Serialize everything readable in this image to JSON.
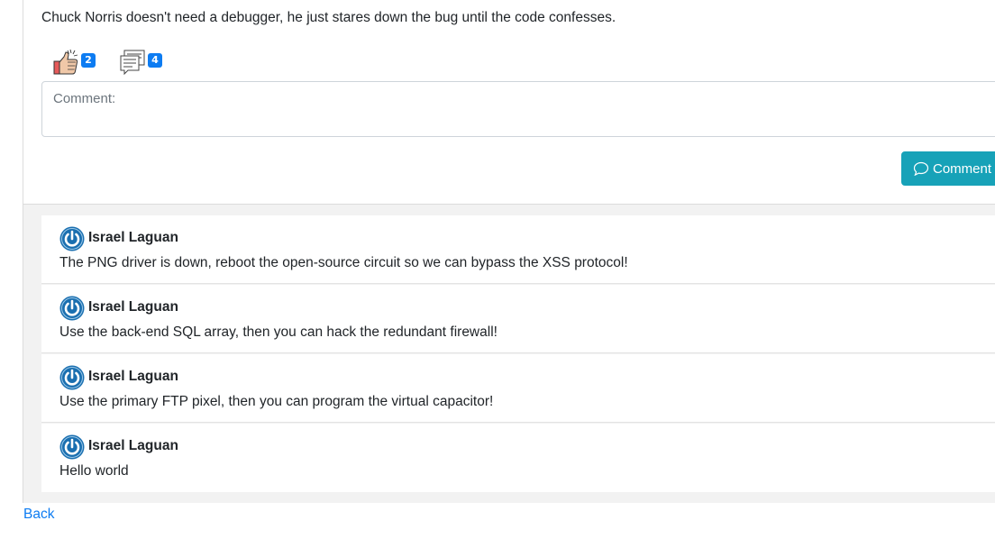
{
  "post": {
    "text": "Chuck Norris doesn't need a debugger, he just stares down the bug until the code confesses.",
    "likes_icon": "thumbs-up-icon",
    "likes_count": "2",
    "comments_icon": "comments-icon",
    "comments_count": "4"
  },
  "comment_form": {
    "placeholder": "Comment:",
    "value": "",
    "submit_label": "Comment",
    "submit_icon": "speech-bubble-icon"
  },
  "comments": [
    {
      "author": "Israel Laguan",
      "avatar_icon": "power-icon",
      "text": "The PNG driver is down, reboot the open-source circuit so we can bypass the XSS protocol!"
    },
    {
      "author": "Israel Laguan",
      "avatar_icon": "power-icon",
      "text": "Use the back-end SQL array, then you can hack the redundant firewall!"
    },
    {
      "author": "Israel Laguan",
      "avatar_icon": "power-icon",
      "text": "Use the primary FTP pixel, then you can program the virtual capacitor!"
    },
    {
      "author": "Israel Laguan",
      "avatar_icon": "power-icon",
      "text": "Hello world"
    }
  ],
  "footer": {
    "back_label": "Back"
  },
  "colors": {
    "accent": "#17a2b8",
    "badge": "#0d7cf2",
    "link": "#0d7cf2",
    "avatar": "#1a6fb0"
  }
}
